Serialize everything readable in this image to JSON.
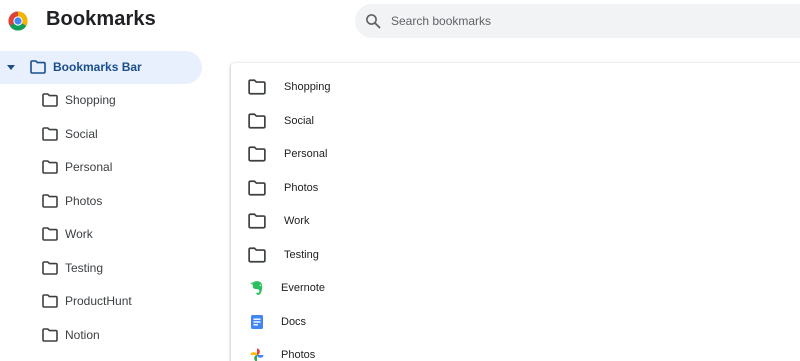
{
  "app": {
    "title": "Bookmarks"
  },
  "search": {
    "placeholder": "Search bookmarks",
    "value": ""
  },
  "sidebar": {
    "root": {
      "label": "Bookmarks Bar",
      "expanded": true,
      "selected": true,
      "icon": "folder-icon"
    },
    "items": [
      {
        "label": "Shopping",
        "icon": "folder-icon"
      },
      {
        "label": "Social",
        "icon": "folder-icon"
      },
      {
        "label": "Personal",
        "icon": "folder-icon"
      },
      {
        "label": "Photos",
        "icon": "folder-icon"
      },
      {
        "label": "Work",
        "icon": "folder-icon"
      },
      {
        "label": "Testing",
        "icon": "folder-icon"
      },
      {
        "label": "ProductHunt",
        "icon": "folder-icon"
      },
      {
        "label": "Notion",
        "icon": "folder-icon"
      }
    ]
  },
  "list": {
    "rows": [
      {
        "label": "Shopping",
        "type": "folder",
        "icon": "folder-icon"
      },
      {
        "label": "Social",
        "type": "folder",
        "icon": "folder-icon"
      },
      {
        "label": "Personal",
        "type": "folder",
        "icon": "folder-icon"
      },
      {
        "label": "Photos",
        "type": "folder",
        "icon": "folder-icon"
      },
      {
        "label": "Work",
        "type": "folder",
        "icon": "folder-icon"
      },
      {
        "label": "Testing",
        "type": "folder",
        "icon": "folder-icon"
      },
      {
        "label": "Evernote",
        "type": "bookmark",
        "icon": "evernote-icon"
      },
      {
        "label": "Docs",
        "type": "bookmark",
        "icon": "google-docs-icon"
      },
      {
        "label": "Photos",
        "type": "bookmark",
        "icon": "google-photos-icon"
      }
    ]
  },
  "colors": {
    "selected_background": "#e8f0fe",
    "selected_text": "#1a4e8a",
    "search_background": "#f1f3f4",
    "evernote_green": "#2dbe60",
    "docs_blue": "#4285f4"
  }
}
